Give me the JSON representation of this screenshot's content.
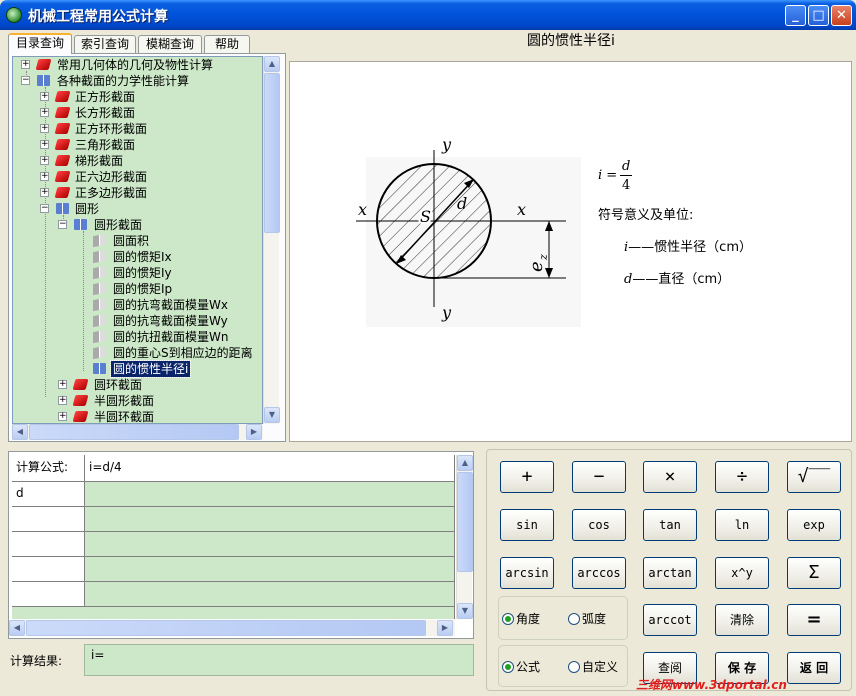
{
  "window": {
    "title": "机械工程常用公式计算",
    "buttons": {
      "minimize": "_",
      "maximize": "□",
      "close": "✕"
    }
  },
  "tabs": [
    "目录查询",
    "索引查询",
    "模糊查询",
    "帮助"
  ],
  "tree": {
    "items": [
      {
        "label": "常用几何体的几何及物性计算"
      },
      {
        "label": "各种截面的力学性能计算"
      },
      {
        "label": "正方形截面"
      },
      {
        "label": "长方形截面"
      },
      {
        "label": "正方环形截面"
      },
      {
        "label": "三角形截面"
      },
      {
        "label": "梯形截面"
      },
      {
        "label": "正六边形截面"
      },
      {
        "label": "正多边形截面"
      },
      {
        "label": "圆形"
      },
      {
        "label": "圆形截面"
      },
      {
        "label": "圆面积"
      },
      {
        "label": "圆的惯矩Ix"
      },
      {
        "label": "圆的惯矩Iy"
      },
      {
        "label": "圆的惯矩Ip"
      },
      {
        "label": "圆的抗弯截面模量Wx"
      },
      {
        "label": "圆的抗弯截面模量Wy"
      },
      {
        "label": "圆的抗扭截面模量Wn"
      },
      {
        "label": "圆的重心S到相应边的距离"
      },
      {
        "label": "圆的惯性半径i"
      },
      {
        "label": "圆环截面"
      },
      {
        "label": "半圆形截面"
      },
      {
        "label": "半圆环截面"
      }
    ]
  },
  "formula": {
    "title": "圆的惯性半径i",
    "lhs": "i =",
    "numerator": "d",
    "denominator": "4",
    "meaning_heading": "符号意义及单位:",
    "symbols": [
      {
        "sym": "i",
        "desc": "——惯性半径（cm）"
      },
      {
        "sym": "d",
        "desc": "——直径（cm）"
      }
    ],
    "diagram": {
      "x_left": "x",
      "x_right": "x",
      "y_top": "y",
      "y_bottom": "y",
      "S": "S",
      "d": "d",
      "ez": "e",
      "ez_sub": "z"
    }
  },
  "grid": {
    "formula_label": "计算公式:",
    "formula_value": "i=d/4",
    "rows": [
      {
        "name": "d",
        "value": ""
      },
      {
        "name": "",
        "value": ""
      },
      {
        "name": "",
        "value": ""
      },
      {
        "name": "",
        "value": ""
      },
      {
        "name": "",
        "value": ""
      }
    ]
  },
  "result": {
    "label": "计算结果:",
    "value": "i="
  },
  "calculator": {
    "row1": [
      "+",
      "−",
      "×",
      "÷",
      "√‾‾"
    ],
    "row2": [
      "sin",
      "cos",
      "tan",
      "ln",
      "exp"
    ],
    "row3": [
      "arcsin",
      "arccos",
      "arctan",
      "x^y",
      "Σ"
    ],
    "row4": [
      "arccot",
      "清除",
      "="
    ],
    "row5": [
      "查阅",
      "保 存",
      "返 回"
    ],
    "angle_mode": {
      "options": [
        "角度",
        "弧度"
      ],
      "selected": "角度"
    },
    "formula_mode": {
      "options": [
        "公式",
        "自定义"
      ],
      "selected": "公式"
    }
  },
  "watermark": "三维网www.3dportal.cn"
}
